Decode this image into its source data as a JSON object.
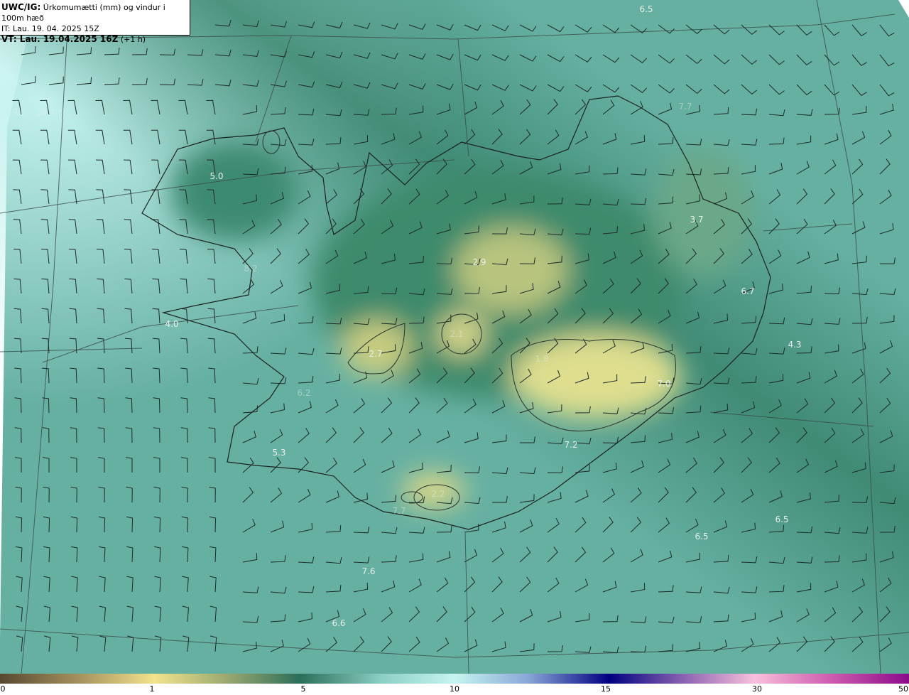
{
  "header": {
    "product": "UWC/IG:",
    "title": "Úrkomumætti (mm) og vindur i 100m hæð",
    "issue_time": "IT: Lau. 19. 04. 2025 15Z",
    "valid_time": "VT: Lau. 19.04.2025 16Z",
    "lead": "(+1 h)"
  },
  "labels": [
    "6.5",
    "9.6",
    "10.4",
    "7.7",
    "5.0",
    "8.2",
    "3.7",
    "2.9",
    "6.7",
    "4.0",
    "2.1",
    "2.7",
    "1.8",
    "4.3",
    "7.0",
    "6.2",
    "5.3",
    "7.2",
    "2.2",
    "7.7",
    "6.5",
    "6.5",
    "7.6",
    "6.6"
  ],
  "colorbar": {
    "ticks": [
      "0",
      "1",
      "5",
      "10",
      "15",
      "30",
      "50"
    ],
    "colors": [
      "#584830",
      "#f2e38c",
      "#2b6e5a",
      "#c6f5f0",
      "#000080",
      "#f8c0dc",
      "#8b0a8b"
    ]
  }
}
